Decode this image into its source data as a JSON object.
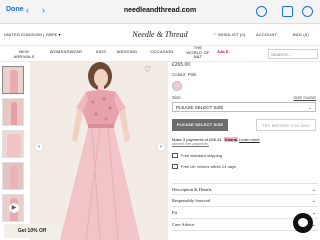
{
  "browser": {
    "done_label": "Done",
    "back_icon": "‹",
    "forward_icon": "›",
    "url": "needleandthread.com"
  },
  "header": {
    "region": "UNITED KINGDOM | GBP£ ▾",
    "logo": "Needle & Thread",
    "wishlist": "♡ WISHLIST (0)",
    "account": "ACCOUNT",
    "bag": "BAG (0)"
  },
  "nav": {
    "new": "NEW ARRIVALS",
    "women": "WOMENSWEAR",
    "kids": "KIDS",
    "wedding": "WEDDING",
    "occasion": "OCCASION",
    "world": "THE WORLD OF N&T",
    "sale": "SALE",
    "search_placeholder": "SEARCH..."
  },
  "product": {
    "price": "£265.00",
    "colour_label": "Colour: Pink",
    "size_label": "Size",
    "size_guide": "SIZE GUIDE",
    "size_select": "PLEASE SELECT SIZE",
    "select_size_button": "PLEASE SELECT SIZE",
    "try_button": "TRY BEFORE YOU BUY",
    "klarna_text": "Make 3 payments of £88.33.",
    "klarna_brand": "Klarna",
    "klarna_more": "Learn more",
    "klarna_sub": "Interest-free payments.",
    "shipping_standard": "Free standard shipping",
    "shipping_returns": "Free UK returns within 14 days"
  },
  "accordion": [
    {
      "label": "Description & Details"
    },
    {
      "label": "Responsibly Sourced"
    },
    {
      "label": "Fit"
    },
    {
      "label": "Care Advice"
    }
  ],
  "promo": {
    "label": "Get 10% Off"
  },
  "colors": {
    "dress_pink": "#e8aab1",
    "sale_red": "#c4002f",
    "link_blue": "#1f6fe0"
  }
}
